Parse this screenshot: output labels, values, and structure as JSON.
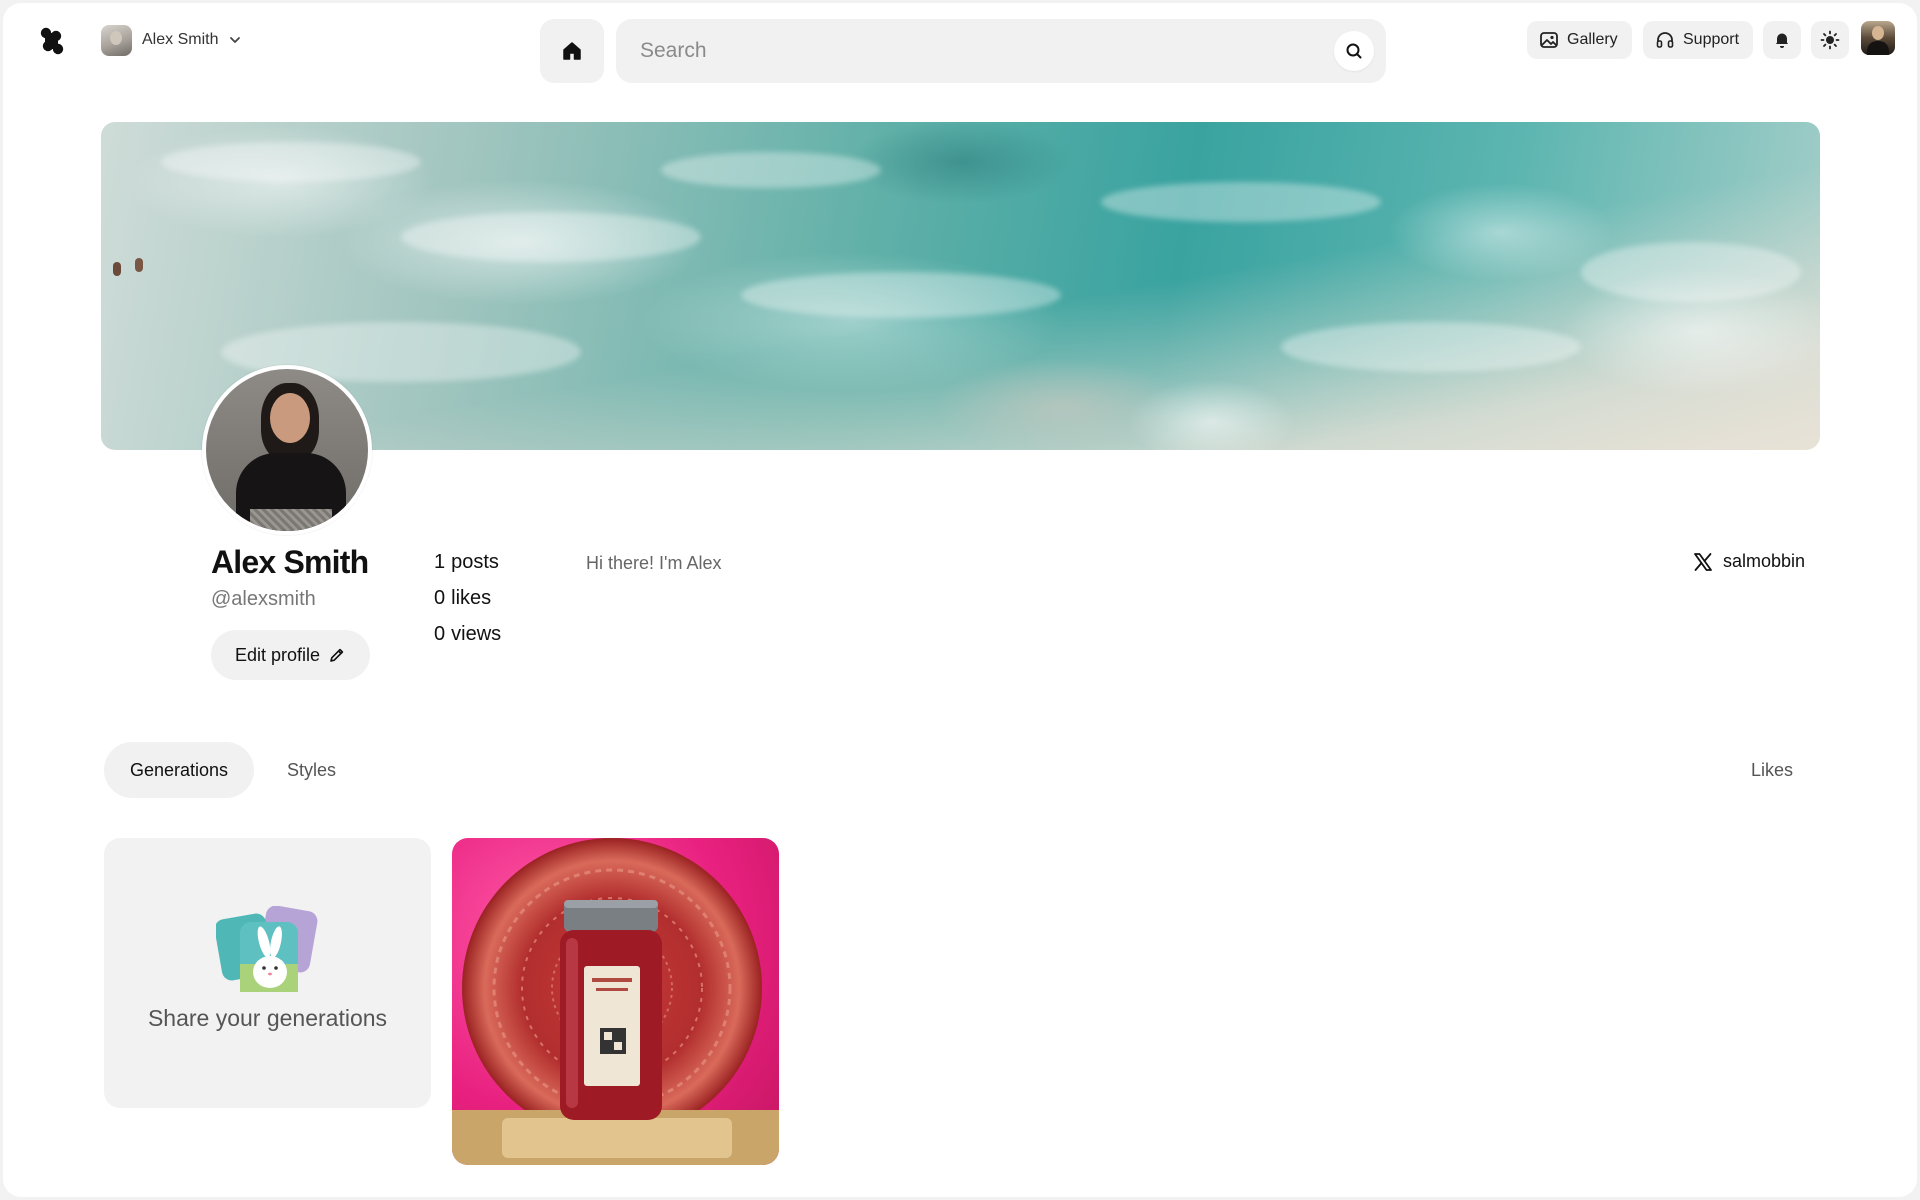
{
  "header": {
    "workspace_name": "Alex Smith",
    "search_placeholder": "Search",
    "gallery_label": "Gallery",
    "support_label": "Support"
  },
  "profile": {
    "display_name": "Alex Smith",
    "handle": "@alexsmith",
    "edit_label": "Edit profile",
    "bio": "Hi there! I'm Alex",
    "stats": [
      {
        "value": "1",
        "label": "posts"
      },
      {
        "value": "0",
        "label": "likes"
      },
      {
        "value": "0",
        "label": "views"
      }
    ],
    "social": {
      "platform_icon": "x-logo-icon",
      "username": "salmobbin"
    }
  },
  "tabs": {
    "generations": "Generations",
    "styles": "Styles",
    "likes": "Likes",
    "active": "Generations"
  },
  "content": {
    "share_label": "Share your generations"
  },
  "colors": {
    "surface": "#f1f1f1",
    "text": "#111111",
    "muted": "#777777"
  }
}
